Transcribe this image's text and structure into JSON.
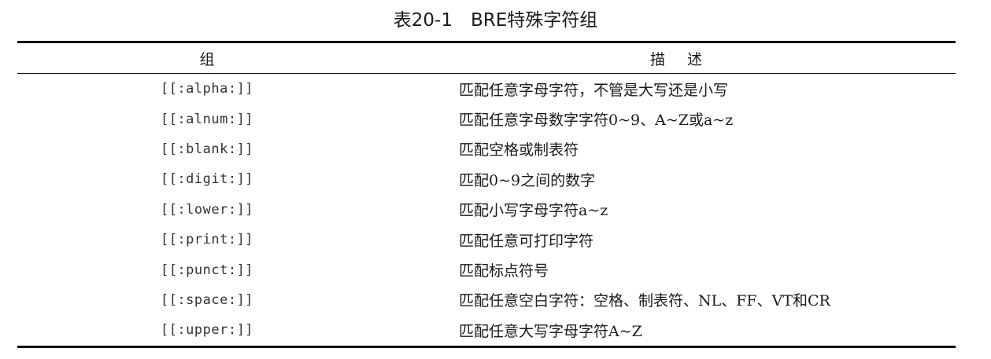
{
  "caption": "表20-1　BRE特殊字符组",
  "table": {
    "headers": [
      "组",
      "描述"
    ],
    "rows": [
      {
        "group": "[[:alpha:]]",
        "desc": "匹配任意字母字符，不管是大写还是小写"
      },
      {
        "group": "[[:alnum:]]",
        "desc": "匹配任意字母数字字符0~9、A~Z或a~z"
      },
      {
        "group": "[[:blank:]]",
        "desc": "匹配空格或制表符"
      },
      {
        "group": "[[:digit:]]",
        "desc": "匹配0~9之间的数字"
      },
      {
        "group": "[[:lower:]]",
        "desc": "匹配小写字母字符a~z"
      },
      {
        "group": "[[:print:]]",
        "desc": "匹配任意可打印字符"
      },
      {
        "group": "[[:punct:]]",
        "desc": "匹配标点符号"
      },
      {
        "group": "[[:space:]]",
        "desc": "匹配任意空白字符：空格、制表符、NL、FF、VT和CR"
      },
      {
        "group": "[[:upper:]]",
        "desc": "匹配任意大写字母字符A~Z"
      }
    ]
  }
}
